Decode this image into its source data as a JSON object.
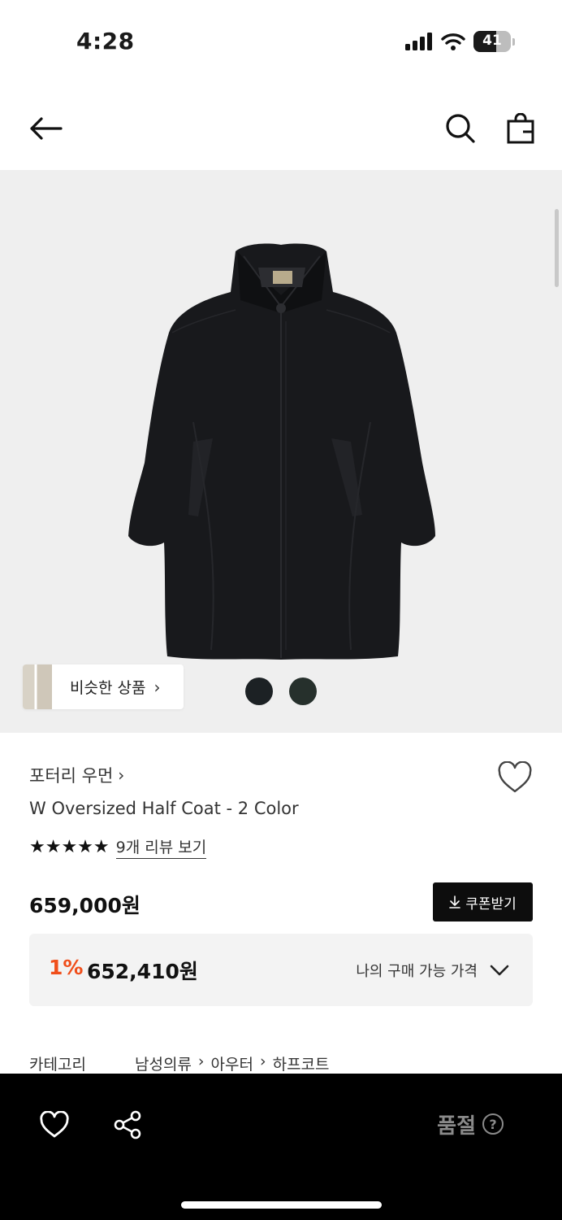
{
  "status_bar": {
    "time": "4:28",
    "battery": "41"
  },
  "product": {
    "brand": "포터리 우먼",
    "title": "W Oversized Half Coat - 2 Color",
    "stars": "★★★★★",
    "review_link": "9개 리뷰 보기",
    "price": "659,000원",
    "coupon_button": "쿠폰받기",
    "discount_rate": "1%",
    "discount_price": "652,410원",
    "my_price_label": "나의 구매 가능 가격",
    "category_label": "카테고리",
    "category_path": [
      "남성의류",
      "아우터",
      "하프코트"
    ]
  },
  "hero": {
    "similar_label": "비슷한 상품",
    "swatches": [
      "#1c2124",
      "#26302c"
    ]
  },
  "bottom_bar": {
    "soldout_label": "품절",
    "help_label": "?"
  },
  "colors": {
    "accent": "#f04e1a",
    "dark": "#0d0d0d",
    "panel": "#f3f3f3",
    "hero_bg": "#efefef"
  }
}
